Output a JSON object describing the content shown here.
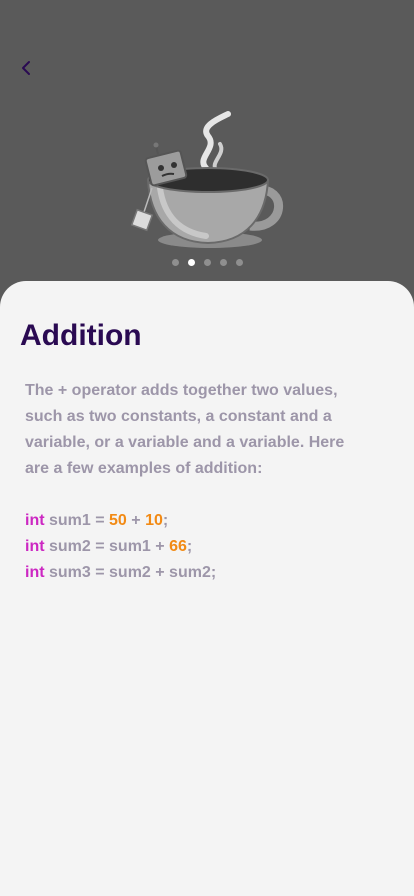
{
  "header": {
    "back_icon": "chevron-left-icon"
  },
  "illustration": {
    "icon": "coffee-cup-with-robot-icon"
  },
  "pager": {
    "total": 5,
    "active_index": 1
  },
  "content": {
    "title": "Addition",
    "description": "The + operator adds together two values, such as two constants, a constant and a variable, or a variable and a variable. Here are a few examples of addition:",
    "code": [
      {
        "kw": "int",
        "a": " sum1 = ",
        "n1": "50",
        "b": " + ",
        "n2": "10",
        "c": ";"
      },
      {
        "kw": "int",
        "a": " sum2 = sum1 + ",
        "n1": "66",
        "b": ";"
      },
      {
        "kw": "int",
        "a": " sum3 = sum2 + sum2;"
      }
    ]
  },
  "colors": {
    "title": "#2a0a52",
    "text": "#9d96a9",
    "keyword": "#cc27c2",
    "number": "#f28a14",
    "header_bg": "#5a5a5a",
    "sheet_bg": "#f4f4f4"
  }
}
